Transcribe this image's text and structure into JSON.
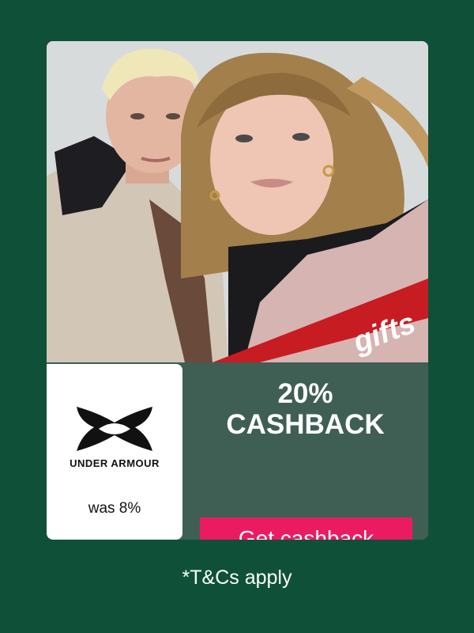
{
  "brand": {
    "name": "UNDER ARMOUR",
    "logo_icon": "under-armour-logo-icon"
  },
  "hero": {
    "banner_text": "gifts",
    "image": "photo-of-two-people-selfie"
  },
  "offer": {
    "percent": "20%",
    "label": "CASHBACK",
    "previous_rate": "was 8%",
    "cta_label": "Get cashback"
  },
  "footer": {
    "terms": "*T&Cs apply"
  },
  "colors": {
    "background": "#0f5138",
    "panel": "#3f5f55",
    "cta": "#eb1b61"
  }
}
